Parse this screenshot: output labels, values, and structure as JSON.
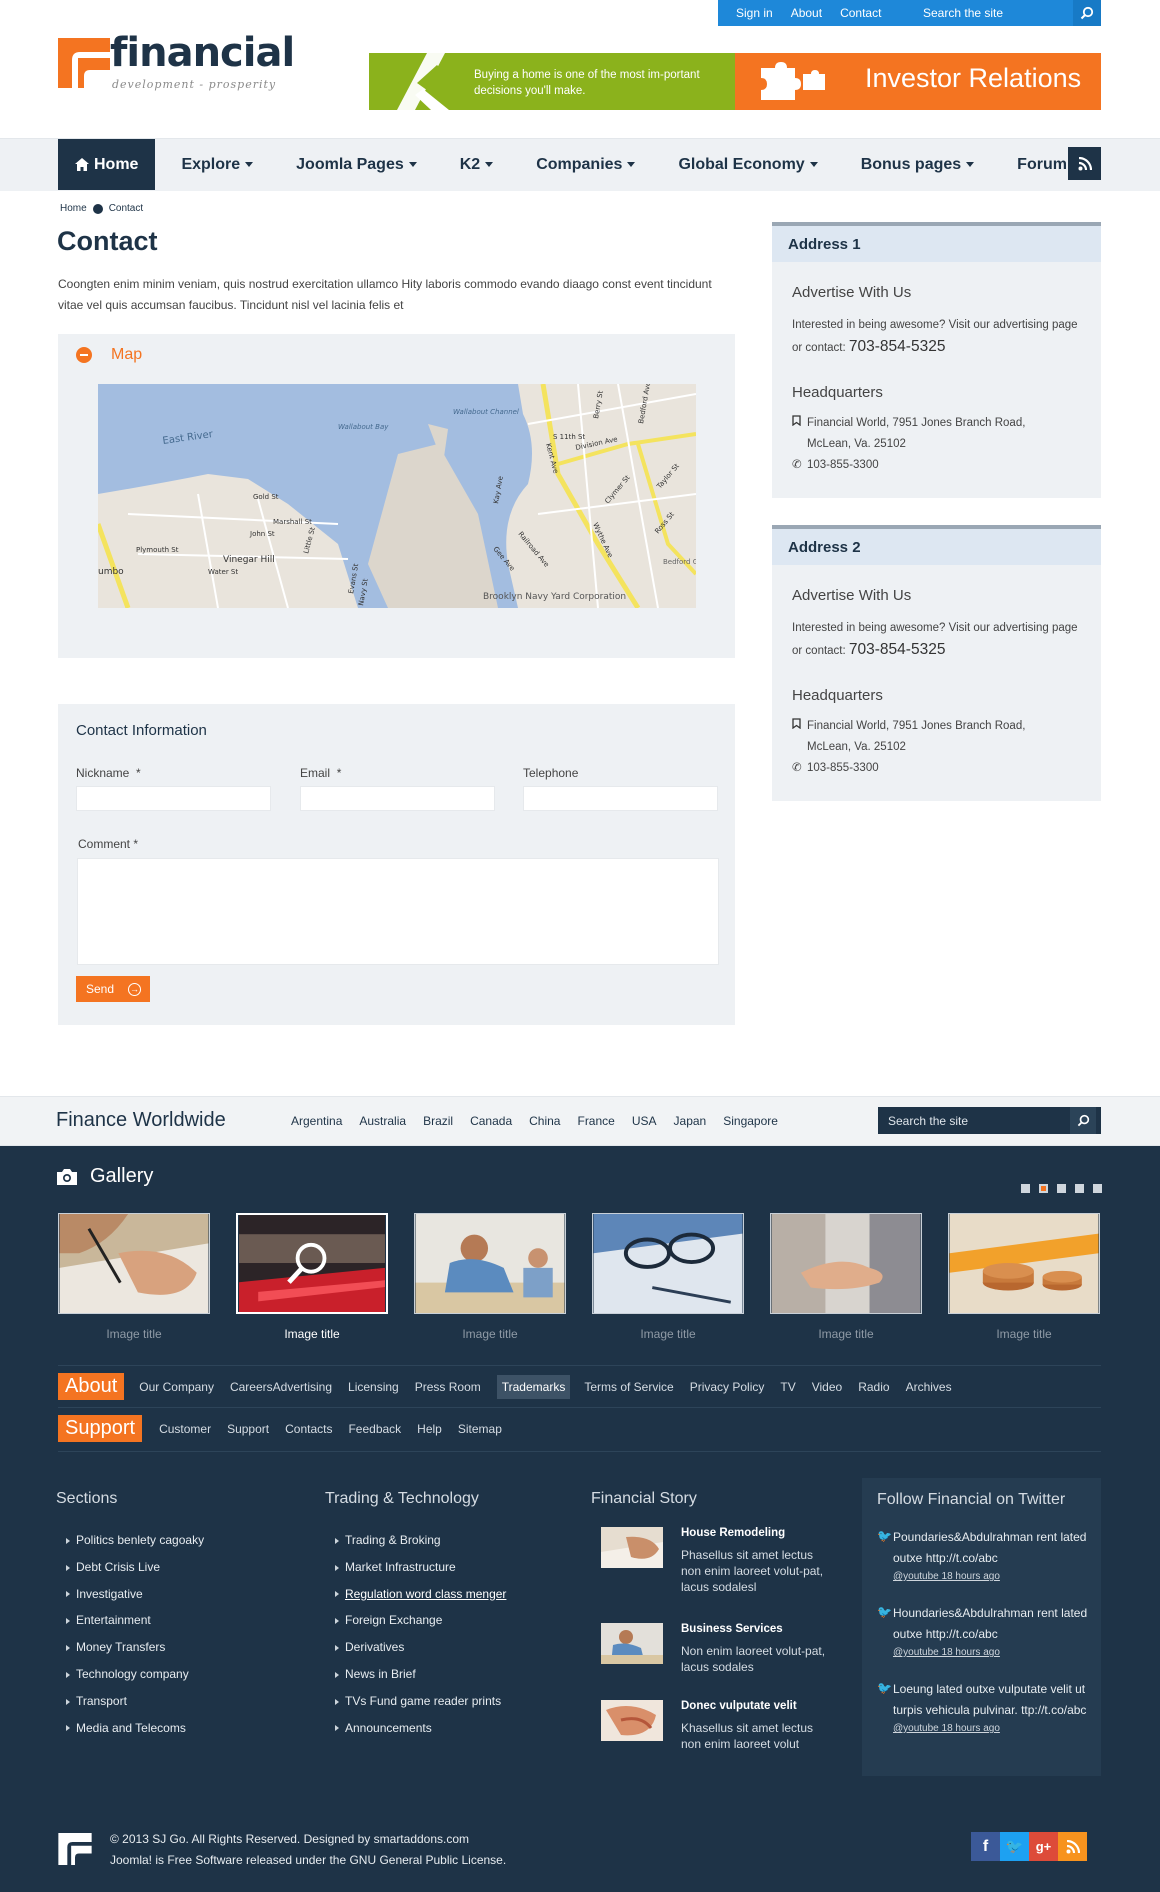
{
  "topbar": {
    "links": [
      "Sign in",
      "About",
      "Contact"
    ],
    "search_placeholder": "Search the site"
  },
  "logo": {
    "name": "financial",
    "tagline": "development - prosperity"
  },
  "banners": {
    "left_text": "Buying a home is one of the most im-portant decisions you'll make.",
    "right_text": "Investor Relations"
  },
  "nav": {
    "items": [
      "Home",
      "Explore",
      "Joomla Pages",
      "K2",
      "Companies",
      "Global Economy",
      "Bonus pages",
      "Forum"
    ],
    "active": "Home"
  },
  "breadcrumb": [
    "Home",
    "Contact"
  ],
  "page": {
    "title": "Contact",
    "intro": "Coongten enim minim veniam, quis nostrud exercitation ullamco Hity laboris commodo evando diaago const event tincidunt vitae vel quis accumsan faucibus. Tincidunt nisl vel lacinia felis et",
    "map_label": "Map"
  },
  "map": {
    "labels": [
      "East River",
      "Wallabout Bay",
      "Wallabout Channel",
      "Kent Ave",
      "S 11th St",
      "Division Ave",
      "Berry St",
      "Bedford Ave",
      "Clymer St",
      "Taylor St",
      "Wythe Ave",
      "Ross St",
      "Bedford Gardens Housing",
      "Kay Ave",
      "Railroad Ave",
      "Gee Ave",
      "Brooklyn Navy Yard Corporation",
      "Marshall St",
      "Gold St",
      "John St",
      "Plymouth St",
      "Vinegar Hill",
      "Water St",
      "Little St",
      "Evans St",
      "Navy St",
      "umbo"
    ]
  },
  "contact_form": {
    "title": "Contact Information",
    "nickname_label": "Nickname",
    "email_label": "Email",
    "telephone_label": "Telephone",
    "comment_label": "Comment",
    "required_mark": "*",
    "send_label": "Send"
  },
  "addresses": [
    {
      "title": "Address 1",
      "advertise_heading": "Advertise With Us",
      "advertise_text": "Interested in being awesome? Visit our advertising page or contact:",
      "advertise_phone": "703-854-5325",
      "hq_heading": "Headquarters",
      "hq_line1": "Financial World, 7951 Jones Branch Road,",
      "hq_line2": "McLean, Va. 25102",
      "hq_phone": "103-855-3300"
    },
    {
      "title": "Address 2",
      "advertise_heading": "Advertise With Us",
      "advertise_text": "Interested in being awesome? Visit our advertising page or contact:",
      "advertise_phone": "703-854-5325",
      "hq_heading": "Headquarters",
      "hq_line1": "Financial World, 7951 Jones Branch Road,",
      "hq_line2": "McLean, Va. 25102",
      "hq_phone": "103-855-3300"
    }
  ],
  "finance_worldwide": {
    "title": "Finance Worldwide",
    "countries": [
      "Argentina",
      "Australia",
      "Brazil",
      "Canada",
      "China",
      "France",
      "USA",
      "Japan",
      "Singapore"
    ],
    "search_placeholder": "Search the site"
  },
  "gallery": {
    "title": "Gallery",
    "captions": [
      "Image title",
      "Image title",
      "Image title",
      "Image title",
      "Image title",
      "Image title"
    ],
    "active_index": 1,
    "page_dots": 5,
    "active_dot": 1
  },
  "about_row": {
    "tag": "About",
    "links": [
      "Our Company",
      "CareersAdvertising",
      "Licensing",
      "Press Room",
      "Trademarks",
      "Terms of Service",
      "Privacy Policy",
      "TV",
      "Video",
      "Radio",
      "Archives"
    ],
    "highlighted": "Trademarks"
  },
  "support_row": {
    "tag": "Support",
    "links": [
      "Customer",
      "Support",
      "Contacts",
      "Feedback",
      "Help",
      "Sitemap"
    ]
  },
  "sections": {
    "title": "Sections",
    "items": [
      "Politics benlety cagoaky",
      "Debt Crisis Live",
      "Investigative",
      "Entertainment",
      "Money Transfers",
      "Technology company",
      "Transport",
      "Media and Telecoms"
    ]
  },
  "trading": {
    "title": "Trading & Technology",
    "items": [
      "Trading & Broking",
      "Market Infrastructure",
      "Regulation word class menger",
      "Foreign Exchange",
      "Derivatives",
      "News in Brief",
      "TVs Fund game reader prints",
      "Announcements"
    ],
    "underlined": "Regulation word class menger"
  },
  "financial_story": {
    "title": "Financial Story",
    "items": [
      {
        "title": "House Remodeling",
        "text": "Phasellus sit amet lectus non enim laoreet volut-pat, lacus sodalesl"
      },
      {
        "title": "Business Services",
        "text": "Non enim laoreet volut-pat, lacus sodales"
      },
      {
        "title": "Donec vulputate velit",
        "text": "Khasellus sit amet lectus non enim laoreet volut"
      }
    ]
  },
  "twitter": {
    "title": "Follow Financial on Twitter",
    "tweets": [
      {
        "text": "Poundaries&Abdulrahman rent lated outxe http://t.co/abc",
        "time": "@youtube 18 hours ago"
      },
      {
        "text": "Houndaries&Abdulrahman rent lated outxe http://t.co/abc",
        "time": "@youtube 18 hours ago"
      },
      {
        "text": "Loeung  lated outxe vulputate velit ut turpis vehicula pulvinar. ttp://t.co/abc",
        "time": "@youtube 18 hours ago"
      }
    ]
  },
  "footer": {
    "line1": "© 2013 SJ Go. All Rights Reserved. Designed by smartaddons.com",
    "line2": "Joomla! is Free Software released under the GNU General Public License.",
    "social": [
      "facebook-icon",
      "twitter-icon",
      "google-plus-icon",
      "rss-icon"
    ]
  },
  "colors": {
    "navy": "#1e3347",
    "orange": "#f47421",
    "blue": "#1e88d9",
    "green": "#8bb21c",
    "panel": "#eef1f4"
  }
}
